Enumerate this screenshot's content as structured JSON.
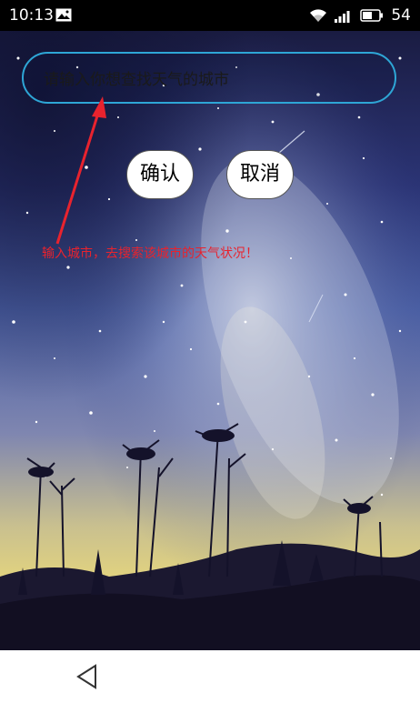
{
  "status_bar": {
    "time": "10:13",
    "battery": "54",
    "icons": [
      "image-icon",
      "wifi-icon",
      "signal-icon",
      "battery-icon"
    ]
  },
  "search": {
    "placeholder": "请输入你想查找天气的城市",
    "value": ""
  },
  "buttons": {
    "confirm_label": "确认",
    "cancel_label": "取消"
  },
  "annotation": {
    "text": "输入城市，去搜索该城市的天气状况！",
    "color": "#e8232e"
  },
  "navigation": {
    "back_icon": "back-triangle-icon"
  },
  "colors": {
    "input_border": "#2ea6d6",
    "annotation": "#e8232e",
    "status_bar": "#000000",
    "nav_bar": "#ffffff"
  }
}
